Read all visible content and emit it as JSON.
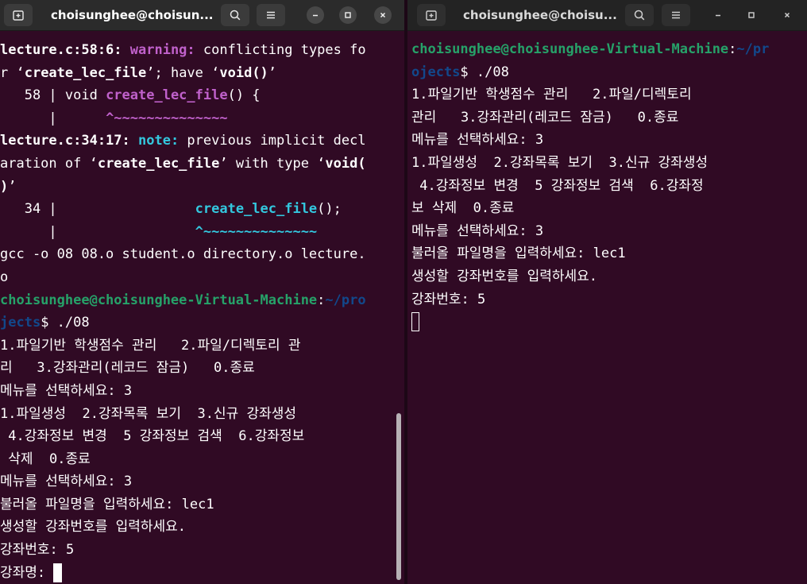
{
  "colors": {
    "terminal_bg": "#300a24",
    "prompt_user": "#26a269",
    "prompt_path": "#12488b",
    "warning": "#c061cb",
    "note": "#33c7de"
  },
  "left": {
    "title": "choisunghee@choisun...",
    "lines": [
      {
        "segments": [
          {
            "t": "lecture.c:58:6: ",
            "s": "b"
          },
          {
            "t": "warning:",
            "s": "p"
          },
          {
            "t": " conflicting types fo",
            "s": ""
          }
        ]
      },
      {
        "segments": [
          {
            "t": "r ‘",
            "s": ""
          },
          {
            "t": "create_lec_file",
            "s": "b"
          },
          {
            "t": "’; have ‘",
            "s": ""
          },
          {
            "t": "void()",
            "s": "b"
          },
          {
            "t": "’",
            "s": ""
          }
        ]
      },
      {
        "segments": [
          {
            "t": "   58 | void ",
            "s": ""
          },
          {
            "t": "create_lec_file",
            "s": "p"
          },
          {
            "t": "() {",
            "s": ""
          }
        ]
      },
      {
        "segments": [
          {
            "t": "      |      ",
            "s": ""
          },
          {
            "t": "^~~~~~~~~~~~~~~",
            "s": "p"
          }
        ]
      },
      {
        "segments": [
          {
            "t": "lecture.c:34:17: ",
            "s": "b"
          },
          {
            "t": "note:",
            "s": "c"
          },
          {
            "t": " previous implicit decl",
            "s": ""
          }
        ]
      },
      {
        "segments": [
          {
            "t": "aration of ‘",
            "s": ""
          },
          {
            "t": "create_lec_file",
            "s": "b"
          },
          {
            "t": "’ with type ‘",
            "s": ""
          },
          {
            "t": "void(",
            "s": "b"
          }
        ]
      },
      {
        "segments": [
          {
            "t": ")",
            "s": "b"
          },
          {
            "t": "’",
            "s": ""
          }
        ]
      },
      {
        "segments": [
          {
            "t": "   34 |                 ",
            "s": ""
          },
          {
            "t": "create_lec_file",
            "s": "c"
          },
          {
            "t": "();",
            "s": ""
          }
        ]
      },
      {
        "segments": [
          {
            "t": "      |                 ",
            "s": ""
          },
          {
            "t": "^~~~~~~~~~~~~~~",
            "s": "c"
          }
        ]
      },
      {
        "segments": [
          {
            "t": "gcc -o 08 08.o student.o directory.o lecture.",
            "s": ""
          }
        ]
      },
      {
        "segments": [
          {
            "t": "o",
            "s": ""
          }
        ]
      },
      {
        "segments": [
          {
            "t": "choisunghee@choisunghee-Virtual-Machine",
            "s": "g"
          },
          {
            "t": ":",
            "s": ""
          },
          {
            "t": "~/pro",
            "s": "bl"
          }
        ]
      },
      {
        "segments": [
          {
            "t": "jects",
            "s": "bl"
          },
          {
            "t": "$ ./08",
            "s": ""
          }
        ]
      },
      {
        "segments": [
          {
            "t": "1.파일기반 학생점수 관리   2.파일/디렉토리 관",
            "s": ""
          }
        ]
      },
      {
        "segments": [
          {
            "t": "리   3.강좌관리(레코드 잠금)   0.종료",
            "s": ""
          }
        ]
      },
      {
        "segments": [
          {
            "t": "메뉴를 선택하세요: 3",
            "s": ""
          }
        ]
      },
      {
        "segments": [
          {
            "t": "1.파일생성  2.강좌목록 보기  3.신규 강좌생성",
            "s": ""
          }
        ]
      },
      {
        "segments": [
          {
            "t": " 4.강좌정보 변경  5 강좌정보 검색  6.강좌정보",
            "s": ""
          }
        ]
      },
      {
        "segments": [
          {
            "t": " 삭제  0.종료",
            "s": ""
          }
        ]
      },
      {
        "segments": [
          {
            "t": "메뉴를 선택하세요: 3",
            "s": ""
          }
        ]
      },
      {
        "segments": [
          {
            "t": "불러올 파일명을 입력하세요: lec1",
            "s": ""
          }
        ]
      },
      {
        "segments": [
          {
            "t": "생성할 강좌번호를 입력하세요.",
            "s": ""
          }
        ]
      },
      {
        "segments": [
          {
            "t": "강좌번호: 5",
            "s": ""
          }
        ]
      },
      {
        "segments": [
          {
            "t": "강좌명: ",
            "s": ""
          }
        ],
        "cursor": "solid"
      }
    ]
  },
  "right": {
    "title": "choisunghee@choisu...",
    "lines": [
      {
        "segments": [
          {
            "t": "choisunghee@choisunghee-Virtual-Machine",
            "s": "g"
          },
          {
            "t": ":",
            "s": ""
          },
          {
            "t": "~/pr",
            "s": "bl"
          }
        ]
      },
      {
        "segments": [
          {
            "t": "ojects",
            "s": "bl"
          },
          {
            "t": "$ ./08",
            "s": ""
          }
        ]
      },
      {
        "segments": [
          {
            "t": "1.파일기반 학생점수 관리   2.파일/디렉토리",
            "s": ""
          }
        ]
      },
      {
        "segments": [
          {
            "t": "관리   3.강좌관리(레코드 잠금)   0.종료",
            "s": ""
          }
        ]
      },
      {
        "segments": [
          {
            "t": "메뉴를 선택하세요: 3",
            "s": ""
          }
        ]
      },
      {
        "segments": [
          {
            "t": "1.파일생성  2.강좌목록 보기  3.신규 강좌생성",
            "s": ""
          }
        ]
      },
      {
        "segments": [
          {
            "t": " 4.강좌정보 변경  5 강좌정보 검색  6.강좌정",
            "s": ""
          }
        ]
      },
      {
        "segments": [
          {
            "t": "보 삭제  0.종료",
            "s": ""
          }
        ]
      },
      {
        "segments": [
          {
            "t": "메뉴를 선택하세요: 3",
            "s": ""
          }
        ]
      },
      {
        "segments": [
          {
            "t": "불러올 파일명을 입력하세요: lec1",
            "s": ""
          }
        ]
      },
      {
        "segments": [
          {
            "t": "생성할 강좌번호를 입력하세요.",
            "s": ""
          }
        ]
      },
      {
        "segments": [
          {
            "t": "강좌번호: 5",
            "s": ""
          }
        ]
      },
      {
        "segments": [
          {
            "t": "",
            "s": ""
          }
        ],
        "cursor": "outline"
      }
    ]
  },
  "icons": {
    "new_tab": "new-tab-icon",
    "search": "search-icon",
    "menu": "hamburger-menu-icon",
    "minimize": "minimize-icon",
    "maximize": "maximize-icon",
    "close": "close-icon"
  }
}
